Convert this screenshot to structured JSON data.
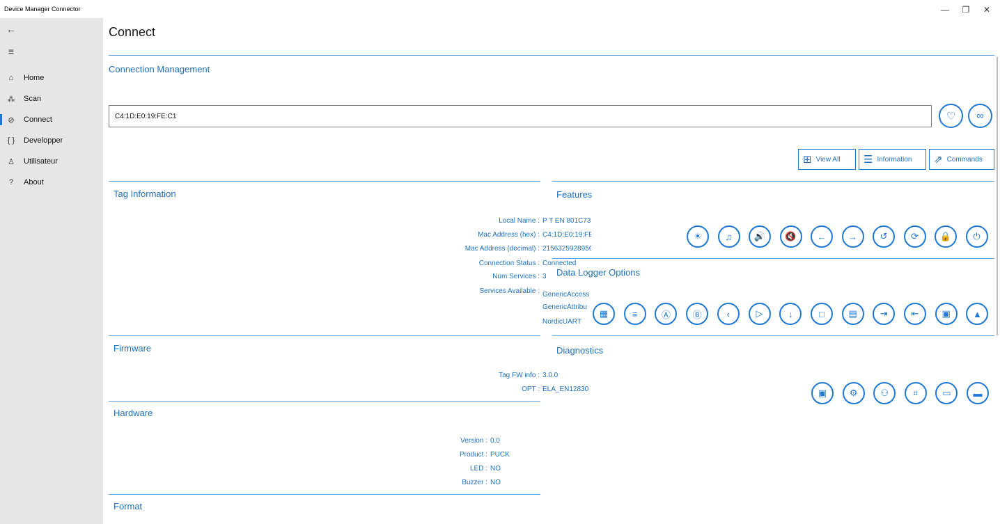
{
  "window": {
    "title": "Device Manager Connector",
    "minimize": "—",
    "restore": "❐",
    "close": "✕"
  },
  "sidebar": {
    "items": [
      {
        "icon": "⌂",
        "label": "Home"
      },
      {
        "icon": "⁂",
        "label": "Scan"
      },
      {
        "icon": "⊘",
        "label": "Connect"
      },
      {
        "icon": "{ }",
        "label": "Developper"
      },
      {
        "icon": "♙",
        "label": "Utilisateur"
      },
      {
        "icon": "?",
        "label": "About"
      }
    ],
    "active": "Connect"
  },
  "main": {
    "page_title": "Connect",
    "connection": {
      "title": "Connection Management",
      "address": "C4:1D:E0:19:FE:C1"
    },
    "view_buttons": [
      {
        "icon": "⊞",
        "label": "View All"
      },
      {
        "icon": "☰",
        "label": "Information"
      },
      {
        "icon": "⇗",
        "label": "Commands"
      }
    ],
    "tag_info": {
      "title": "Tag Information",
      "rows": [
        {
          "label": "Local Name :",
          "value": "P T EN 801C73"
        },
        {
          "label": "Mac Address (hex) :",
          "value": "C4:1D:E0:19:FE:C"
        },
        {
          "label": "Mac Address (decimal) :",
          "value": "2156325928956"
        },
        {
          "label": "Connection Status :",
          "value": "Connected"
        },
        {
          "label": "Num Services :",
          "value": "3"
        },
        {
          "label": "Services Available :",
          "value": "GenericAccess"
        },
        {
          "label": "",
          "value": "GenericAttribu"
        },
        {
          "label": "",
          "value": "NordicUART"
        }
      ]
    },
    "firmware": {
      "title": "Firmware",
      "rows": [
        {
          "label": "Tag FW info :",
          "value": "3.0.0"
        },
        {
          "label": "OPT :",
          "value": "ELA_EN12830"
        }
      ]
    },
    "hardware": {
      "title": "Hardware",
      "rows": [
        {
          "label": "Version :",
          "value": "0.0"
        },
        {
          "label": "Product :",
          "value": "PUCK"
        },
        {
          "label": "LED :",
          "value": "NO"
        },
        {
          "label": "Buzzer :",
          "value": "NO"
        }
      ]
    },
    "format": {
      "title": "Format"
    },
    "features": {
      "title": "Features",
      "icons": [
        "light-icon",
        "bell-off-icon",
        "volume-icon",
        "mute-icon",
        "arrow-left-icon",
        "arrow-right-icon",
        "device-refresh-icon",
        "sync-off-icon",
        "lock-icon",
        "power-icon"
      ],
      "glyphs": [
        "☀",
        "♫",
        "🔊",
        "🔇",
        "←",
        "→",
        "↺",
        "⟳",
        "🔒",
        "⏻"
      ]
    },
    "data_logger": {
      "title": "Data Logger Options",
      "icons": [
        "chart-icon",
        "settings-sliders-icon",
        "a-icon",
        "b-icon",
        "back-icon",
        "play-icon",
        "download-icon",
        "stop-icon",
        "calendar-icon",
        "export-icon",
        "import-icon",
        "report-icon",
        "graph-icon"
      ],
      "glyphs": [
        "▦",
        "≡",
        "Ⓐ",
        "Ⓑ",
        "‹",
        "▷",
        "↓",
        "□",
        "▤",
        "⇥",
        "⇤",
        "▣",
        "▲"
      ]
    },
    "diagnostics": {
      "title": "Diagnostics",
      "icons": [
        "chip-icon",
        "gears-icon",
        "user-settings-icon",
        "scan-settings-icon",
        "monitor-icon",
        "battery-icon"
      ],
      "glyphs": [
        "▣",
        "⚙",
        "⚇",
        "⌗",
        "▭",
        "▬"
      ]
    }
  }
}
